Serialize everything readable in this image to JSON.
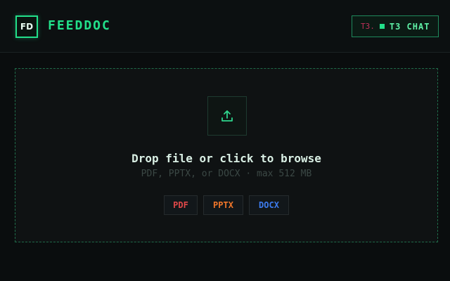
{
  "header": {
    "logo_text": "FD",
    "brand": "FEEDDOC",
    "chip": {
      "prefix": "T3.",
      "label": "T3 CHAT"
    }
  },
  "dropzone": {
    "icon": "upload-icon",
    "title": "Drop file or click to browse",
    "subtitle": "PDF, PPTX, or DOCX · max 512 MB",
    "types": [
      {
        "label": "PDF",
        "color": "#e04848"
      },
      {
        "label": "PPTX",
        "color": "#f0762a"
      },
      {
        "label": "DOCX",
        "color": "#3d7cf0"
      }
    ]
  },
  "colors": {
    "accent": "#22e08a",
    "background": "#0a0d0e"
  }
}
